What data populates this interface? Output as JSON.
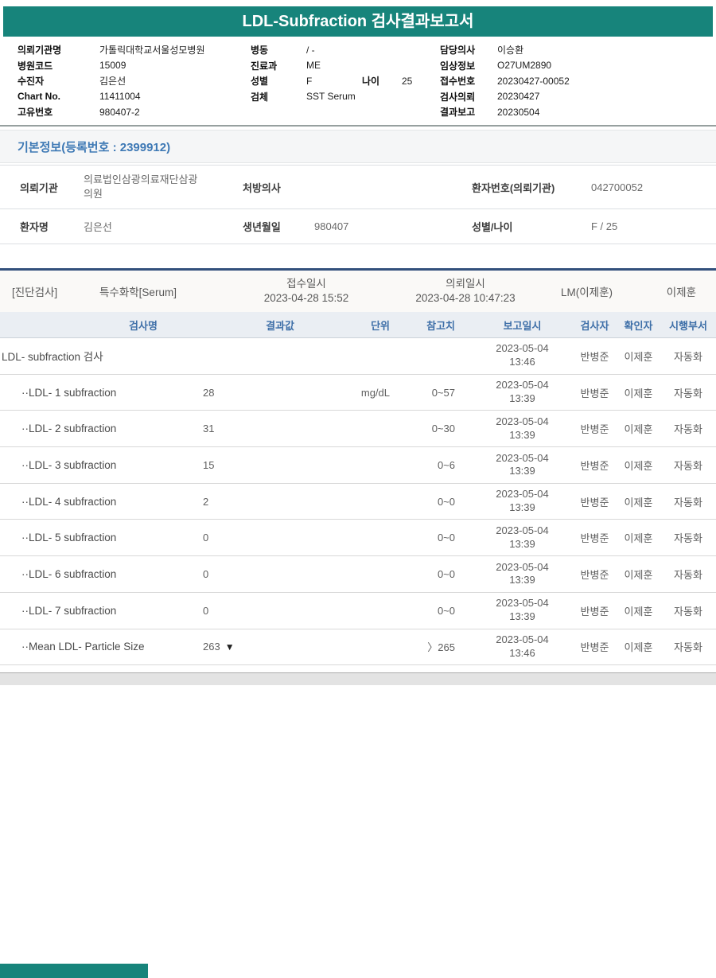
{
  "colors": {
    "teal": "#17847B",
    "navy_divider": "#32507C",
    "section_title_blue": "#3E79B5",
    "table_header_blue": "#3E6FA8",
    "table_header_bg": "#EAEEF3",
    "band_bg": "#FAF9F7",
    "panel_bg": "#F5F6F7",
    "strip_gray": "#E3E3E3"
  },
  "title": "LDL-Subfraction 검사결과보고서",
  "header": {
    "left": [
      [
        {
          "label": "의뢰기관명",
          "value": "가톨릭대학교서울성모병원"
        }
      ],
      [
        {
          "label": "병원코드",
          "value": "15009"
        }
      ],
      [
        {
          "label": "수진자",
          "value": "김은선"
        }
      ],
      [
        {
          "label": "Chart No.",
          "value": "11411004"
        }
      ],
      [
        {
          "label": "고유번호",
          "value": "980407-2"
        }
      ]
    ],
    "middle": [
      [
        {
          "label": "병동",
          "value": "/ -"
        }
      ],
      [
        {
          "label": "진료과",
          "value": "ME"
        }
      ],
      [
        {
          "label": "성별",
          "value": "F"
        },
        {
          "label": "나이",
          "value": "25"
        }
      ],
      [
        {
          "label": "검체",
          "value": "SST Serum"
        }
      ]
    ],
    "right": [
      [
        {
          "label": "담당의사",
          "value": "이승환"
        }
      ],
      [
        {
          "label": "임상정보",
          "value": "O27UM2890"
        }
      ],
      [
        {
          "label": "접수번호",
          "value": "20230427-00052"
        }
      ],
      [
        {
          "label": "검사의뢰",
          "value": "20230427"
        }
      ],
      [
        {
          "label": "결과보고",
          "value": "20230504"
        }
      ]
    ]
  },
  "basic_info": {
    "title": "기본정보(등록번호 : 2399912)"
  },
  "patient_table": {
    "rows": [
      [
        {
          "label": "의뢰기관",
          "value": "의료법인삼광의료재단삼광의원"
        },
        {
          "label": "처방의사",
          "value": ""
        },
        {
          "label": "환자번호(의뢰기관)",
          "value": "042700052"
        }
      ],
      [
        {
          "label": "환자명",
          "value": "김은선"
        },
        {
          "label": "생년월일",
          "value": "980407"
        },
        {
          "label": "성별/나이",
          "value": "F / 25"
        }
      ]
    ]
  },
  "section_band": {
    "dept": "[진단검사]",
    "category": "특수화학[Serum]",
    "receipt_label": "접수일시",
    "receipt_datetime": "2023-04-28 15:52",
    "request_label": "의뢰일시",
    "request_datetime": "2023-04-28 10:47:23",
    "lm": "LM(이제훈)",
    "reader": "이제훈"
  },
  "results_table": {
    "headers": [
      "검사명",
      "결과값",
      "단위",
      "참고치",
      "보고일시",
      "검사자",
      "확인자",
      "시행부서"
    ],
    "rows": [
      {
        "name": "LDL- subfraction 검사",
        "indent": false,
        "result": "",
        "flag": "",
        "unit": "",
        "ref": "",
        "date": "2023-05-04",
        "time": "13:46",
        "tester": "반병준",
        "confirmer": "이제훈",
        "dept": "자동화"
      },
      {
        "name": "··LDL- 1 subfraction",
        "indent": true,
        "result": "28",
        "flag": "",
        "unit": "mg/dL",
        "ref": "0~57",
        "date": "2023-05-04",
        "time": "13:39",
        "tester": "반병준",
        "confirmer": "이제훈",
        "dept": "자동화"
      },
      {
        "name": "··LDL- 2 subfraction",
        "indent": true,
        "result": "31",
        "flag": "",
        "unit": "",
        "ref": "0~30",
        "date": "2023-05-04",
        "time": "13:39",
        "tester": "반병준",
        "confirmer": "이제훈",
        "dept": "자동화"
      },
      {
        "name": "··LDL- 3 subfraction",
        "indent": true,
        "result": "15",
        "flag": "",
        "unit": "",
        "ref": "0~6",
        "date": "2023-05-04",
        "time": "13:39",
        "tester": "반병준",
        "confirmer": "이제훈",
        "dept": "자동화"
      },
      {
        "name": "··LDL- 4 subfraction",
        "indent": true,
        "result": "2",
        "flag": "",
        "unit": "",
        "ref": "0~0",
        "date": "2023-05-04",
        "time": "13:39",
        "tester": "반병준",
        "confirmer": "이제훈",
        "dept": "자동화"
      },
      {
        "name": "··LDL- 5 subfraction",
        "indent": true,
        "result": "0",
        "flag": "",
        "unit": "",
        "ref": "0~0",
        "date": "2023-05-04",
        "time": "13:39",
        "tester": "반병준",
        "confirmer": "이제훈",
        "dept": "자동화"
      },
      {
        "name": "··LDL- 6 subfraction",
        "indent": true,
        "result": "0",
        "flag": "",
        "unit": "",
        "ref": "0~0",
        "date": "2023-05-04",
        "time": "13:39",
        "tester": "반병준",
        "confirmer": "이제훈",
        "dept": "자동화"
      },
      {
        "name": "··LDL- 7 subfraction",
        "indent": true,
        "result": "0",
        "flag": "",
        "unit": "",
        "ref": "0~0",
        "date": "2023-05-04",
        "time": "13:39",
        "tester": "반병준",
        "confirmer": "이제훈",
        "dept": "자동화"
      },
      {
        "name": "··Mean LDL- Particle Size",
        "indent": true,
        "result": "263",
        "flag": "▼",
        "unit": "",
        "ref": "〉265",
        "date": "2023-05-04",
        "time": "13:46",
        "tester": "반병준",
        "confirmer": "이제훈",
        "dept": "자동화"
      }
    ]
  }
}
